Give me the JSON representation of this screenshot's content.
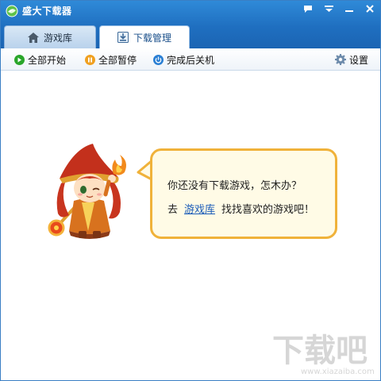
{
  "app": {
    "title": "盛大下载器"
  },
  "tabs": [
    {
      "label": "游戏库",
      "icon": "home-icon",
      "active": false
    },
    {
      "label": "下载管理",
      "icon": "download-icon",
      "active": true
    }
  ],
  "toolbar": {
    "start_all": "全部开始",
    "pause_all": "全部暂停",
    "shutdown_after": "完成后关机",
    "settings": "设置"
  },
  "empty_state": {
    "message": "你还没有下载游戏，怎木办？",
    "prefix": "去",
    "link_label": "游戏库",
    "suffix": "找找喜欢的游戏吧！"
  },
  "watermark": {
    "brand": "下载吧",
    "url": "www.xiazaiba.com"
  },
  "colors": {
    "titlebar": "#1f6fc0",
    "accent_green": "#2aa62a",
    "accent_orange": "#f0a020",
    "accent_blue": "#2a7fd4",
    "bubble_border": "#f0b23a",
    "bubble_fill": "#fffbe6",
    "link": "#1a5bb8"
  }
}
